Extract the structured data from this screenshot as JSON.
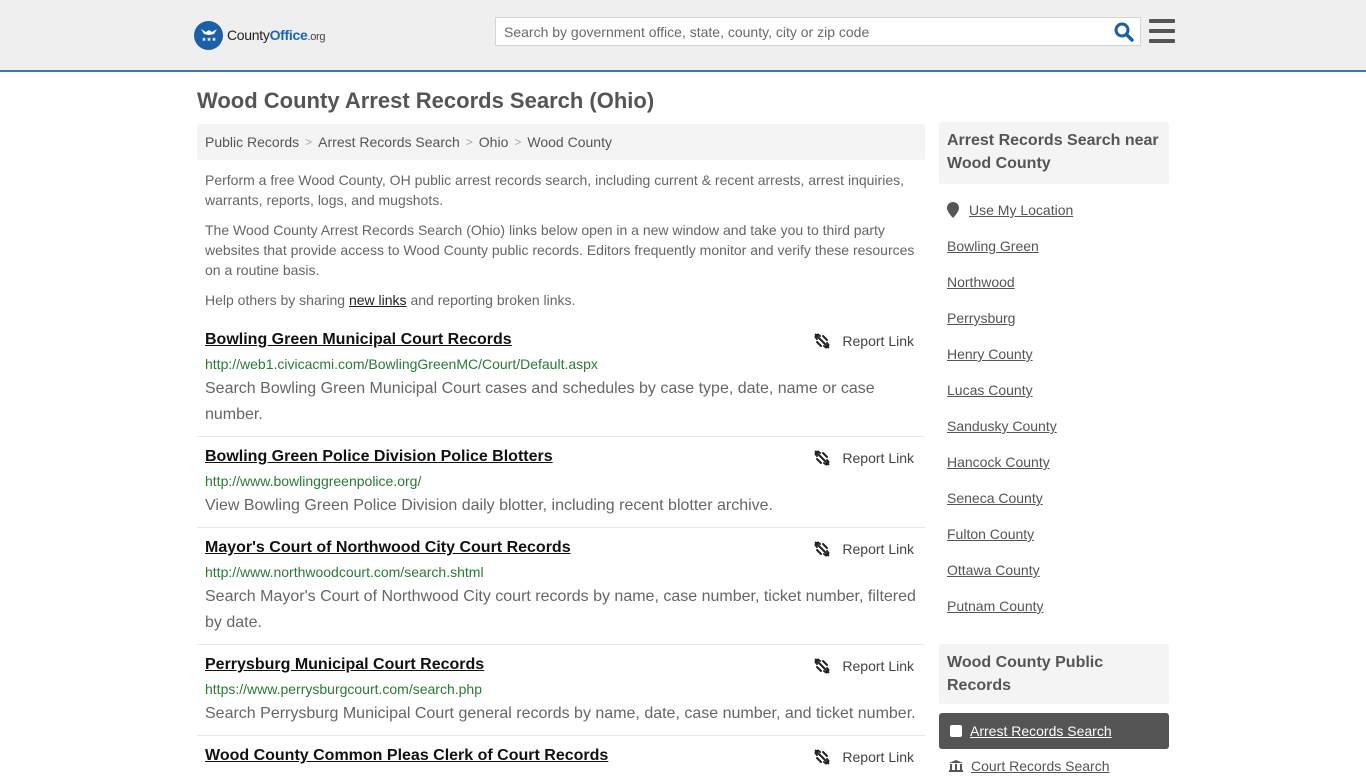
{
  "header": {
    "logo": {
      "name_part1": "County",
      "name_part2": "Office",
      "name_part3": ".org"
    },
    "search": {
      "placeholder": "Search by government office, state, county, city or zip code",
      "value": ""
    },
    "colors": {
      "brand_blue": "#1b5fa6",
      "accent_border": "#3a7ab0"
    }
  },
  "page": {
    "title": "Wood County Arrest Records Search (Ohio)",
    "breadcrumb": [
      "Public Records",
      "Arrest Records Search",
      "Ohio",
      "Wood County"
    ],
    "intro": {
      "p1": "Perform a free Wood County, OH public arrest records search, including current & recent arrests, arrest inquiries, warrants, reports, logs, and mugshots.",
      "p2": "The Wood County Arrest Records Search (Ohio) links below open in a new window and take you to third party websites that provide access to Wood County public records. Editors frequently monitor and verify these resources on a routine basis.",
      "p3_before": "Help others by sharing ",
      "p3_link": "new links",
      "p3_after": " and reporting broken links."
    }
  },
  "results": [
    {
      "title": "Bowling Green Municipal Court Records",
      "url": "http://web1.civicacmi.com/BowlingGreenMC/Court/Default.aspx",
      "description": "Search Bowling Green Municipal Court cases and schedules by case type, date, name or case number.",
      "report_label": "Report Link"
    },
    {
      "title": "Bowling Green Police Division Police Blotters",
      "url": "http://www.bowlinggreenpolice.org/",
      "description": "View Bowling Green Police Division daily blotter, including recent blotter archive.",
      "report_label": "Report Link"
    },
    {
      "title": "Mayor's Court of Northwood City Court Records",
      "url": "http://www.northwoodcourt.com/search.shtml",
      "description": "Search Mayor's Court of Northwood City court records by name, case number, ticket number, filtered by date.",
      "report_label": "Report Link"
    },
    {
      "title": "Perrysburg Municipal Court Records",
      "url": "https://www.perrysburgcourt.com/search.php",
      "description": "Search Perrysburg Municipal Court general records by name, date, case number, and ticket number.",
      "report_label": "Report Link"
    },
    {
      "title": "Wood County Common Pleas Clerk of Court Records",
      "url": "",
      "description": "",
      "report_label": "Report Link"
    }
  ],
  "sidebar": {
    "nearby_heading": "Arrest Records Search near Wood County",
    "use_location": "Use My Location",
    "nearby_links": [
      "Bowling Green",
      "Northwood",
      "Perrysburg",
      "Henry County",
      "Lucas County",
      "Sandusky County",
      "Hancock County",
      "Seneca County",
      "Fulton County",
      "Ottawa County",
      "Putnam County"
    ],
    "public_records_heading": "Wood County Public Records",
    "active_item": "Arrest Records Search",
    "next_item": "Court Records Search"
  }
}
